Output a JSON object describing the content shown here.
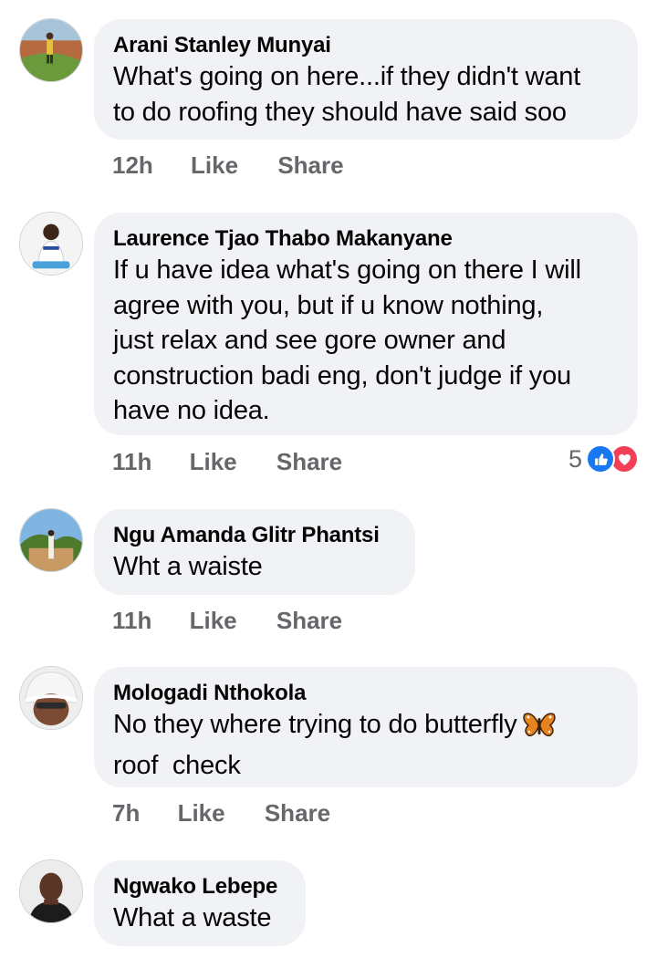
{
  "comments": [
    {
      "author": "Arani Stanley Munyai",
      "lines": [
        "What's going on here...if they didn't want",
        "to do roofing they should have said soo"
      ],
      "time": "12h",
      "like_label": "Like",
      "share_label": "Share"
    },
    {
      "author": "Laurence Tjao Thabo Makanyane",
      "lines": [
        "If u have idea what's going on there I will",
        "agree with you, but if u know nothing,",
        "just relax and see gore owner and",
        "construction badi eng, don't judge if you",
        "have no idea."
      ],
      "time": "11h",
      "like_label": "Like",
      "share_label": "Share",
      "reaction_count": "5",
      "reactions": [
        "like-icon",
        "love-icon"
      ]
    },
    {
      "author": "Ngu Amanda Glitr Phantsi",
      "lines": [
        "Wht a waiste"
      ],
      "time": "11h",
      "like_label": "Like",
      "share_label": "Share"
    },
    {
      "author": "Mologadi Nthokola",
      "lines": [
        "No they where trying to do butterfly",
        "roof  check"
      ],
      "emoji": "butterfly-emoji",
      "time": "7h",
      "like_label": "Like",
      "share_label": "Share"
    },
    {
      "author": "Ngwako Lebepe",
      "lines": [
        "What a waste"
      ]
    }
  ],
  "colors": {
    "bubble_bg": "#f0f2f5",
    "meta_text": "#65676b",
    "like_blue": "#1877f2",
    "love_red": "#f33e58"
  }
}
